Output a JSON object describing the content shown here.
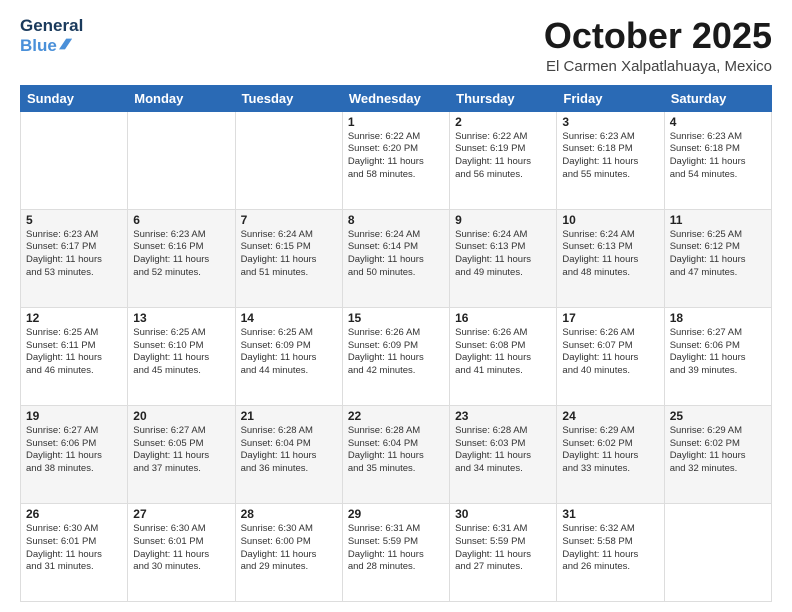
{
  "header": {
    "logo_line1": "General",
    "logo_line2": "Blue",
    "month": "October 2025",
    "location": "El Carmen Xalpatlahuaya, Mexico"
  },
  "weekdays": [
    "Sunday",
    "Monday",
    "Tuesday",
    "Wednesday",
    "Thursday",
    "Friday",
    "Saturday"
  ],
  "weeks": [
    [
      {
        "day": "",
        "info": ""
      },
      {
        "day": "",
        "info": ""
      },
      {
        "day": "",
        "info": ""
      },
      {
        "day": "1",
        "info": "Sunrise: 6:22 AM\nSunset: 6:20 PM\nDaylight: 11 hours\nand 58 minutes."
      },
      {
        "day": "2",
        "info": "Sunrise: 6:22 AM\nSunset: 6:19 PM\nDaylight: 11 hours\nand 56 minutes."
      },
      {
        "day": "3",
        "info": "Sunrise: 6:23 AM\nSunset: 6:18 PM\nDaylight: 11 hours\nand 55 minutes."
      },
      {
        "day": "4",
        "info": "Sunrise: 6:23 AM\nSunset: 6:18 PM\nDaylight: 11 hours\nand 54 minutes."
      }
    ],
    [
      {
        "day": "5",
        "info": "Sunrise: 6:23 AM\nSunset: 6:17 PM\nDaylight: 11 hours\nand 53 minutes."
      },
      {
        "day": "6",
        "info": "Sunrise: 6:23 AM\nSunset: 6:16 PM\nDaylight: 11 hours\nand 52 minutes."
      },
      {
        "day": "7",
        "info": "Sunrise: 6:24 AM\nSunset: 6:15 PM\nDaylight: 11 hours\nand 51 minutes."
      },
      {
        "day": "8",
        "info": "Sunrise: 6:24 AM\nSunset: 6:14 PM\nDaylight: 11 hours\nand 50 minutes."
      },
      {
        "day": "9",
        "info": "Sunrise: 6:24 AM\nSunset: 6:13 PM\nDaylight: 11 hours\nand 49 minutes."
      },
      {
        "day": "10",
        "info": "Sunrise: 6:24 AM\nSunset: 6:13 PM\nDaylight: 11 hours\nand 48 minutes."
      },
      {
        "day": "11",
        "info": "Sunrise: 6:25 AM\nSunset: 6:12 PM\nDaylight: 11 hours\nand 47 minutes."
      }
    ],
    [
      {
        "day": "12",
        "info": "Sunrise: 6:25 AM\nSunset: 6:11 PM\nDaylight: 11 hours\nand 46 minutes."
      },
      {
        "day": "13",
        "info": "Sunrise: 6:25 AM\nSunset: 6:10 PM\nDaylight: 11 hours\nand 45 minutes."
      },
      {
        "day": "14",
        "info": "Sunrise: 6:25 AM\nSunset: 6:09 PM\nDaylight: 11 hours\nand 44 minutes."
      },
      {
        "day": "15",
        "info": "Sunrise: 6:26 AM\nSunset: 6:09 PM\nDaylight: 11 hours\nand 42 minutes."
      },
      {
        "day": "16",
        "info": "Sunrise: 6:26 AM\nSunset: 6:08 PM\nDaylight: 11 hours\nand 41 minutes."
      },
      {
        "day": "17",
        "info": "Sunrise: 6:26 AM\nSunset: 6:07 PM\nDaylight: 11 hours\nand 40 minutes."
      },
      {
        "day": "18",
        "info": "Sunrise: 6:27 AM\nSunset: 6:06 PM\nDaylight: 11 hours\nand 39 minutes."
      }
    ],
    [
      {
        "day": "19",
        "info": "Sunrise: 6:27 AM\nSunset: 6:06 PM\nDaylight: 11 hours\nand 38 minutes."
      },
      {
        "day": "20",
        "info": "Sunrise: 6:27 AM\nSunset: 6:05 PM\nDaylight: 11 hours\nand 37 minutes."
      },
      {
        "day": "21",
        "info": "Sunrise: 6:28 AM\nSunset: 6:04 PM\nDaylight: 11 hours\nand 36 minutes."
      },
      {
        "day": "22",
        "info": "Sunrise: 6:28 AM\nSunset: 6:04 PM\nDaylight: 11 hours\nand 35 minutes."
      },
      {
        "day": "23",
        "info": "Sunrise: 6:28 AM\nSunset: 6:03 PM\nDaylight: 11 hours\nand 34 minutes."
      },
      {
        "day": "24",
        "info": "Sunrise: 6:29 AM\nSunset: 6:02 PM\nDaylight: 11 hours\nand 33 minutes."
      },
      {
        "day": "25",
        "info": "Sunrise: 6:29 AM\nSunset: 6:02 PM\nDaylight: 11 hours\nand 32 minutes."
      }
    ],
    [
      {
        "day": "26",
        "info": "Sunrise: 6:30 AM\nSunset: 6:01 PM\nDaylight: 11 hours\nand 31 minutes."
      },
      {
        "day": "27",
        "info": "Sunrise: 6:30 AM\nSunset: 6:01 PM\nDaylight: 11 hours\nand 30 minutes."
      },
      {
        "day": "28",
        "info": "Sunrise: 6:30 AM\nSunset: 6:00 PM\nDaylight: 11 hours\nand 29 minutes."
      },
      {
        "day": "29",
        "info": "Sunrise: 6:31 AM\nSunset: 5:59 PM\nDaylight: 11 hours\nand 28 minutes."
      },
      {
        "day": "30",
        "info": "Sunrise: 6:31 AM\nSunset: 5:59 PM\nDaylight: 11 hours\nand 27 minutes."
      },
      {
        "day": "31",
        "info": "Sunrise: 6:32 AM\nSunset: 5:58 PM\nDaylight: 11 hours\nand 26 minutes."
      },
      {
        "day": "",
        "info": ""
      }
    ]
  ]
}
